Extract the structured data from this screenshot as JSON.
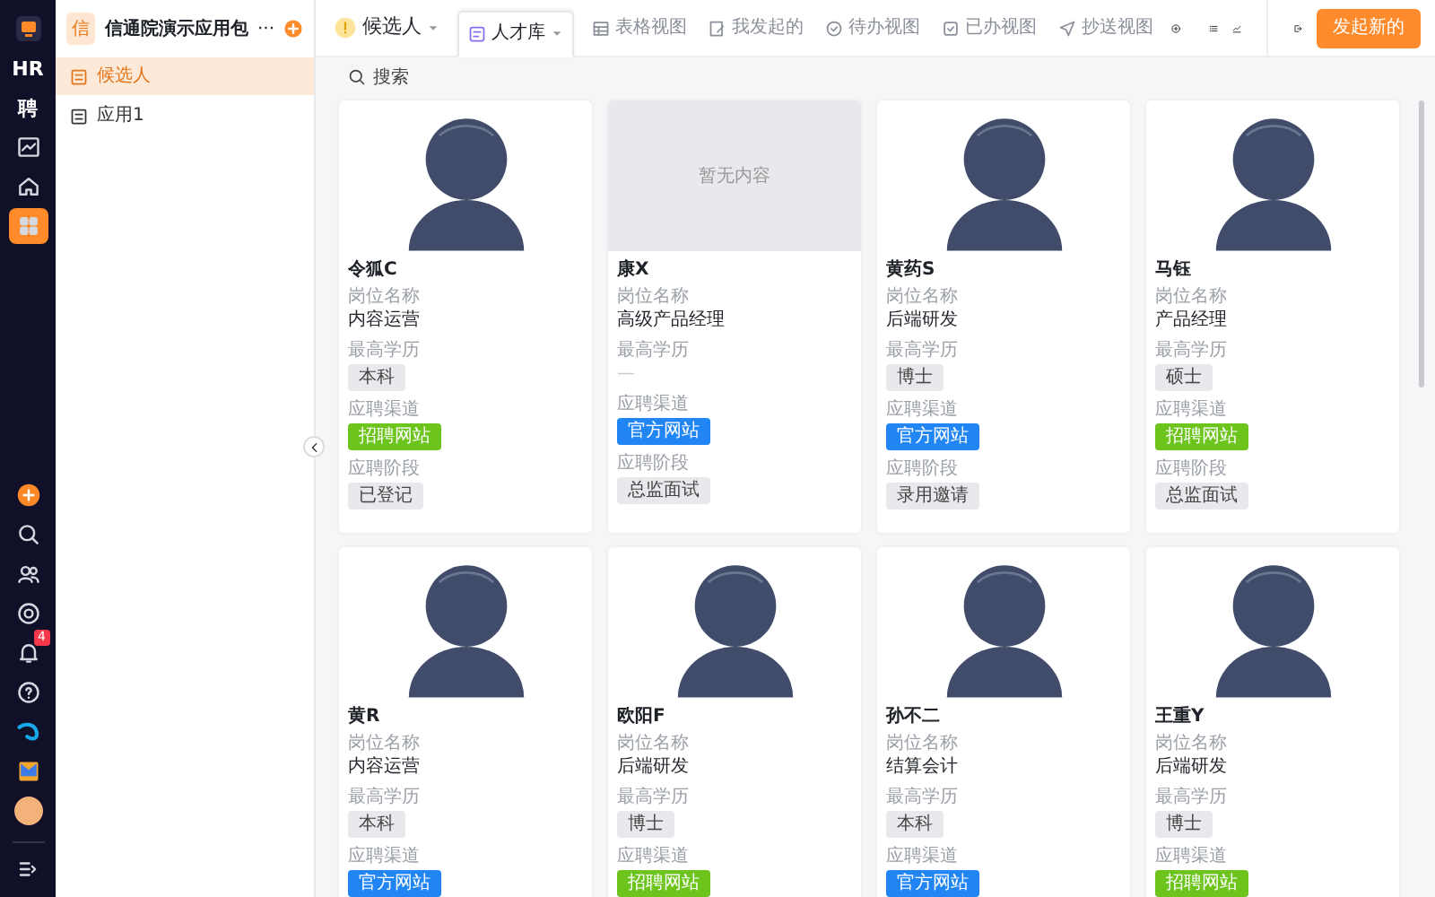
{
  "rail": {
    "top": [
      {
        "kind": "logo"
      },
      {
        "kind": "text",
        "text": "HR"
      },
      {
        "kind": "text",
        "text": "聘"
      },
      {
        "kind": "icon",
        "selected": false
      },
      {
        "kind": "icon",
        "selected": false
      },
      {
        "kind": "icon",
        "selected": true
      }
    ],
    "notification_badge": "4"
  },
  "sidebar": {
    "app_initial": "信",
    "title": "信通院演示应用包",
    "more": "···",
    "items": [
      {
        "label": "候选人",
        "selected": true
      },
      {
        "label": "应用1",
        "selected": false
      }
    ]
  },
  "tabs": [
    {
      "label": "候选人",
      "kind": "form",
      "selected": false
    },
    {
      "label": "人才库",
      "kind": "view",
      "selected": true
    },
    {
      "label": "表格视图",
      "kind": "table",
      "selected": false
    },
    {
      "label": "我发起的",
      "kind": "mine",
      "selected": false
    },
    {
      "label": "待办视图",
      "kind": "todo",
      "selected": false
    },
    {
      "label": "已办视图",
      "kind": "done",
      "selected": false
    },
    {
      "label": "抄送视图",
      "kind": "send",
      "selected": false
    }
  ],
  "primary_button": "发起新的",
  "search": {
    "placeholder": "搜索"
  },
  "cards": [
    {
      "kind": "avatar",
      "name": "令狐C",
      "fields": [
        {
          "label": "岗位名称",
          "value": "内容运营",
          "kind": "text"
        },
        {
          "label": "最高学历",
          "value": "本科",
          "kind": "tag"
        },
        {
          "label": "应聘渠道",
          "value": "招聘网站",
          "kind": "tag",
          "color": "#6cc41c"
        },
        {
          "label": "应聘阶段",
          "value": "已登记",
          "kind": "tag"
        }
      ]
    },
    {
      "kind": "empty",
      "photo_text": "暂无内容",
      "name": "康X",
      "fields": [
        {
          "label": "岗位名称",
          "value": "高级产品经理",
          "kind": "text"
        },
        {
          "label": "最高学历",
          "value": "—",
          "kind": "empty"
        },
        {
          "label": "应聘渠道",
          "value": "官方网站",
          "kind": "tag",
          "color": "#2186f4"
        },
        {
          "label": "应聘阶段",
          "value": "总监面试",
          "kind": "tag"
        }
      ]
    },
    {
      "kind": "avatar",
      "name": "黄药S",
      "fields": [
        {
          "label": "岗位名称",
          "value": "后端研发",
          "kind": "text"
        },
        {
          "label": "最高学历",
          "value": "博士",
          "kind": "tag"
        },
        {
          "label": "应聘渠道",
          "value": "官方网站",
          "kind": "tag",
          "color": "#2186f4"
        },
        {
          "label": "应聘阶段",
          "value": "录用邀请",
          "kind": "tag"
        }
      ]
    },
    {
      "kind": "avatar",
      "name": "马钰",
      "fields": [
        {
          "label": "岗位名称",
          "value": "产品经理",
          "kind": "text"
        },
        {
          "label": "最高学历",
          "value": "硕士",
          "kind": "tag"
        },
        {
          "label": "应聘渠道",
          "value": "招聘网站",
          "kind": "tag",
          "color": "#6cc41c"
        },
        {
          "label": "应聘阶段",
          "value": "总监面试",
          "kind": "tag"
        }
      ]
    },
    {
      "kind": "avatar",
      "name": "黄R",
      "fields": [
        {
          "label": "岗位名称",
          "value": "内容运营",
          "kind": "text"
        },
        {
          "label": "最高学历",
          "value": "本科",
          "kind": "tag"
        },
        {
          "label": "应聘渠道",
          "value": "官方网站",
          "kind": "tag",
          "color": "#2186f4"
        }
      ]
    },
    {
      "kind": "avatar",
      "name": "欧阳F",
      "fields": [
        {
          "label": "岗位名称",
          "value": "后端研发",
          "kind": "text"
        },
        {
          "label": "最高学历",
          "value": "博士",
          "kind": "tag"
        },
        {
          "label": "应聘渠道",
          "value": "招聘网站",
          "kind": "tag",
          "color": "#6cc41c"
        }
      ]
    },
    {
      "kind": "avatar",
      "name": "孙不二",
      "fields": [
        {
          "label": "岗位名称",
          "value": "结算会计",
          "kind": "text"
        },
        {
          "label": "最高学历",
          "value": "本科",
          "kind": "tag"
        },
        {
          "label": "应聘渠道",
          "value": "官方网站",
          "kind": "tag",
          "color": "#2186f4"
        }
      ]
    },
    {
      "kind": "avatar",
      "name": "王重Y",
      "fields": [
        {
          "label": "岗位名称",
          "value": "后端研发",
          "kind": "text"
        },
        {
          "label": "最高学历",
          "value": "博士",
          "kind": "tag"
        },
        {
          "label": "应聘渠道",
          "value": "招聘网站",
          "kind": "tag",
          "color": "#6cc41c"
        }
      ]
    }
  ]
}
